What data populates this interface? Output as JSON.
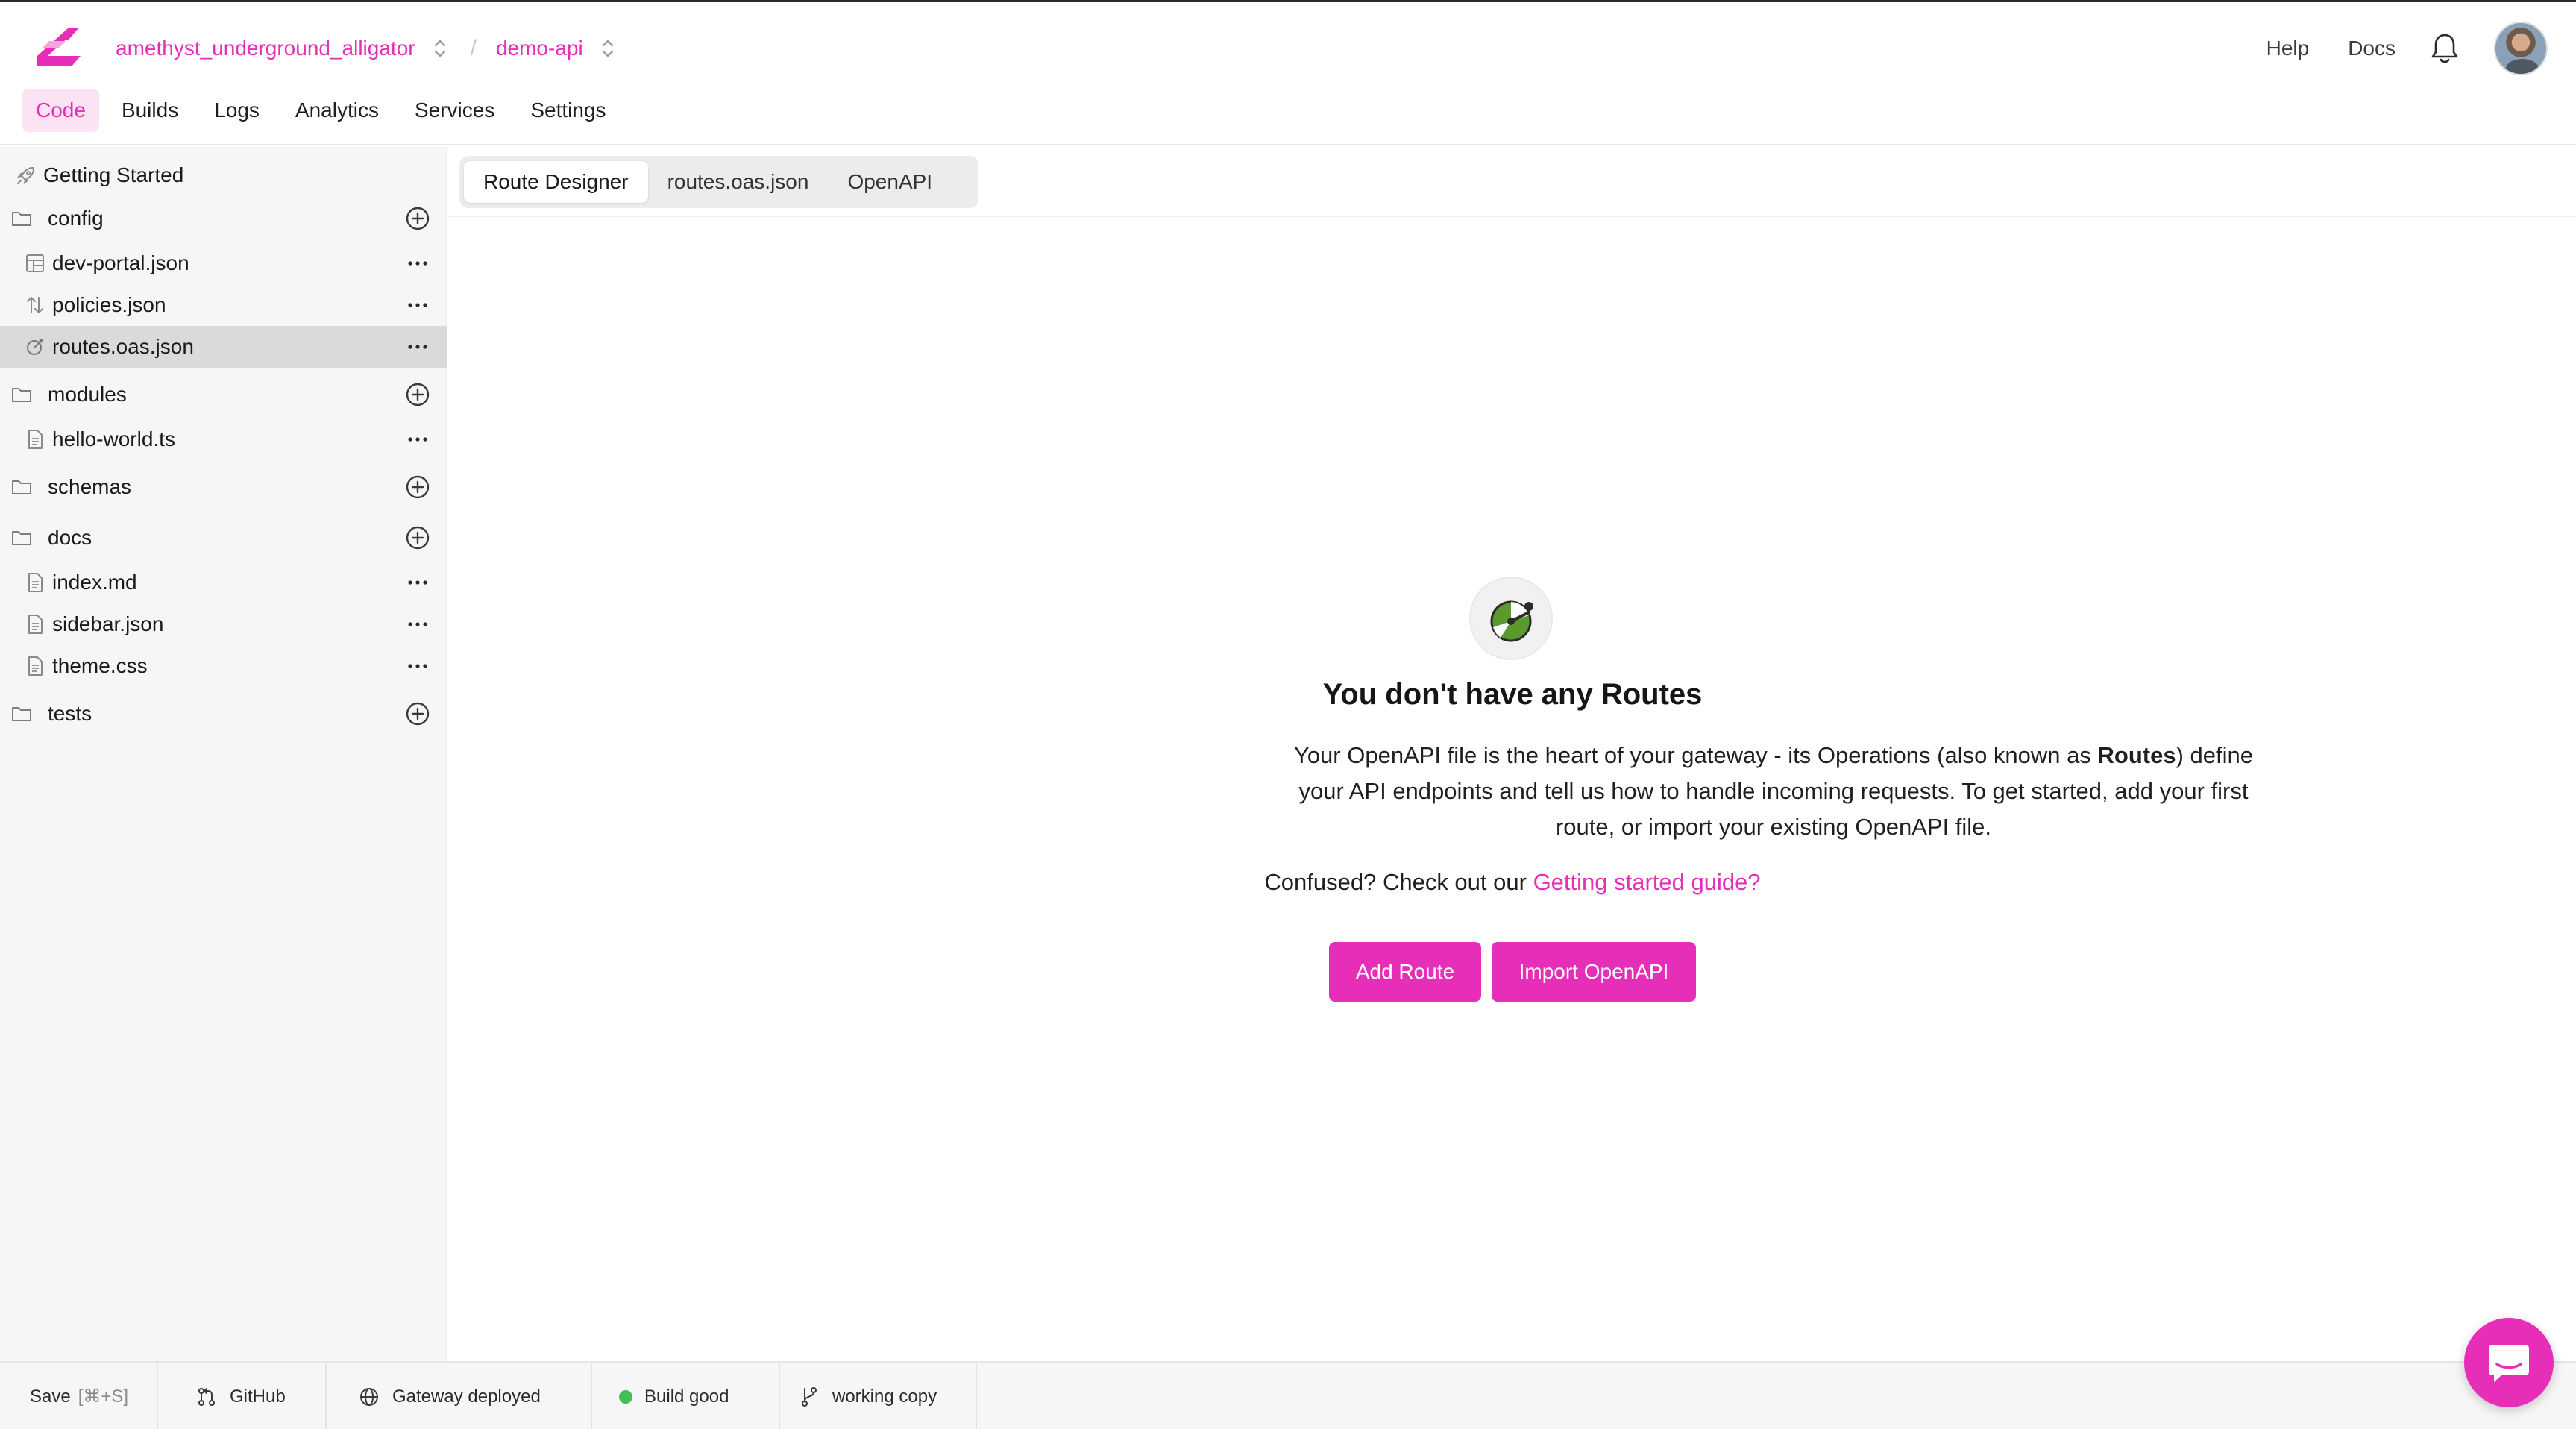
{
  "header": {
    "org_name": "amethyst_underground_alligator",
    "separator": "/",
    "project_name": "demo-api",
    "help_label": "Help",
    "docs_label": "Docs"
  },
  "nav": {
    "tabs": [
      {
        "label": "Code",
        "active": true
      },
      {
        "label": "Builds",
        "active": false
      },
      {
        "label": "Logs",
        "active": false
      },
      {
        "label": "Analytics",
        "active": false
      },
      {
        "label": "Services",
        "active": false
      },
      {
        "label": "Settings",
        "active": false
      }
    ]
  },
  "sidebar": {
    "getting_started": "Getting Started",
    "tree": [
      {
        "type": "folder",
        "label": "config",
        "icon": "folder-icon"
      },
      {
        "type": "file",
        "label": "dev-portal.json",
        "icon": "layout-icon"
      },
      {
        "type": "file",
        "label": "policies.json",
        "icon": "arrows-up-down-icon"
      },
      {
        "type": "file",
        "label": "routes.oas.json",
        "icon": "routes-icon",
        "selected": true
      },
      {
        "type": "folder",
        "label": "modules",
        "icon": "folder-icon"
      },
      {
        "type": "file",
        "label": "hello-world.ts",
        "icon": "file-icon"
      },
      {
        "type": "folder",
        "label": "schemas",
        "icon": "folder-icon"
      },
      {
        "type": "folder",
        "label": "docs",
        "icon": "folder-icon"
      },
      {
        "type": "file",
        "label": "index.md",
        "icon": "file-icon"
      },
      {
        "type": "file",
        "label": "sidebar.json",
        "icon": "file-icon"
      },
      {
        "type": "file",
        "label": "theme.css",
        "icon": "file-icon"
      },
      {
        "type": "folder",
        "label": "tests",
        "icon": "folder-icon"
      }
    ]
  },
  "editor": {
    "tabs": [
      {
        "label": "Route Designer",
        "active": true
      },
      {
        "label": "routes.oas.json",
        "active": false
      },
      {
        "label": "OpenAPI",
        "active": false
      }
    ]
  },
  "empty_state": {
    "title": "You don't have any Routes",
    "desc_part1": "Your OpenAPI file is the heart of your gateway - its Operations (also known as ",
    "desc_bold": "Routes",
    "desc_part2": ") define your API endpoints and tell us how to handle incoming requests. To get started, add your first route, or import your existing OpenAPI file.",
    "confused_prefix": "Confused? Check out our ",
    "confused_link": "Getting started guide?",
    "add_route_label": "Add Route",
    "import_label": "Import OpenAPI"
  },
  "statusbar": {
    "save_label": "Save",
    "save_shortcut": "[⌘+S]",
    "github_label": "GitHub",
    "gateway_label": "Gateway deployed",
    "build_label": "Build good",
    "build_status_color": "#3fbf55",
    "branch_label": "working copy"
  },
  "colors": {
    "accent": "#e62eb8",
    "accent_soft": "#fbe3f4",
    "sidebar_bg": "#f6f6f6",
    "selected_row": "#dadada"
  }
}
